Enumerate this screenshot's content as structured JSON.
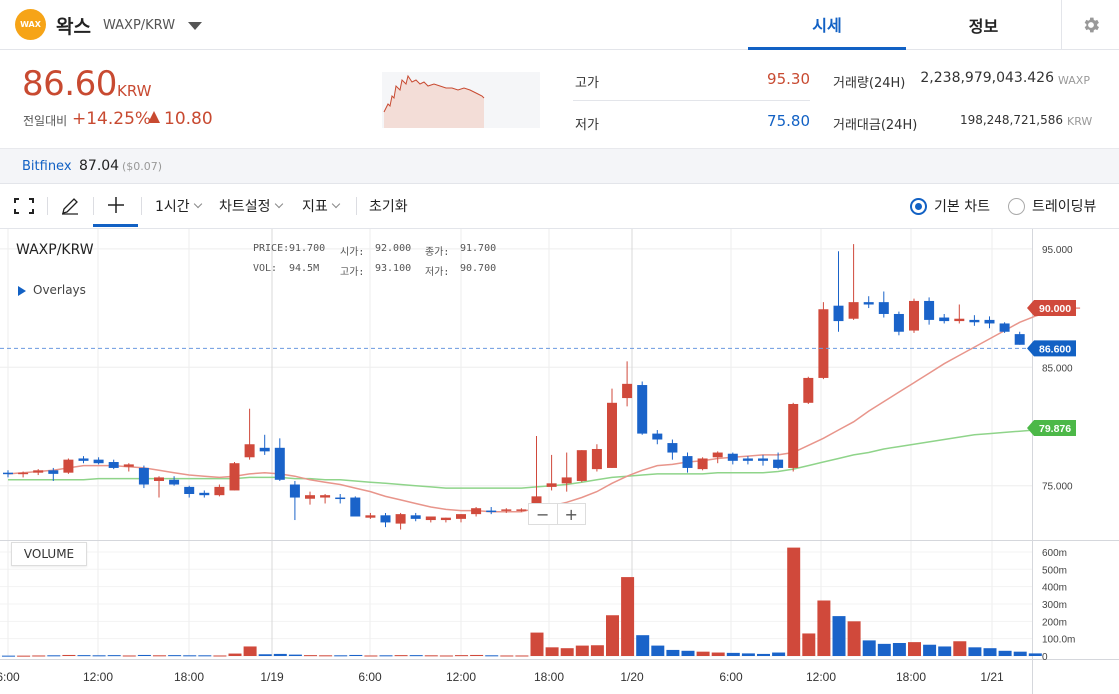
{
  "header": {
    "logo_text": "WAX",
    "coin_name": "왁스",
    "pair": "WAXP/KRW",
    "tabs": [
      "시세",
      "정보"
    ]
  },
  "summary": {
    "price": "86.60",
    "unit": "KRW",
    "change_label": "전일대비",
    "change_rate": "+14.25%",
    "change_amount": "10.80",
    "high_label": "고가",
    "high": "95.30",
    "low_label": "저가",
    "low": "75.80",
    "volume_label": "거래량(24H)",
    "volume": "2,238,979,043.426",
    "volume_unit": "WAXP",
    "value_label": "거래대금(24H)",
    "value": "198,248,721,586",
    "value_unit": "KRW"
  },
  "exchange": {
    "name": "Bitfinex",
    "price": "87.04",
    "diff": "($0.07)"
  },
  "toolbar": {
    "interval": "1시간",
    "chart_settings": "차트설정",
    "indicators": "지표",
    "reset": "초기화",
    "basic_chart": "기본 차트",
    "tradingview": "트레이딩뷰"
  },
  "chart": {
    "pair": "WAXP/KRW",
    "overlays_label": "Overlays",
    "ohlc": {
      "price_label": "PRICE:",
      "price": "91.700",
      "open_label": "시가:",
      "open": "92.000",
      "close_label": "종가:",
      "close": "91.700",
      "vol_label": "VOL:",
      "vol": "94.5M",
      "high_label": "고가:",
      "high": "93.100",
      "low_label": "저가:",
      "low": "90.700"
    },
    "volume_label": "VOLUME",
    "price_ticks": [
      "95.000",
      "85.000",
      "75.000"
    ],
    "volume_ticks": [
      "600m",
      "500m",
      "400m",
      "300m",
      "200m",
      "100.0m",
      "0"
    ],
    "time_ticks": [
      "6:00",
      "12:00",
      "18:00",
      "1/19",
      "6:00",
      "12:00",
      "18:00",
      "1/20",
      "6:00",
      "12:00",
      "18:00",
      "1/21"
    ],
    "markers": {
      "ma_short": "90.000",
      "last": "86.600",
      "ma_long": "79.876"
    },
    "colors": {
      "up": "#d0493b",
      "down": "#1a63c9",
      "ma_short": "#e8958b",
      "ma_long": "#8fd48a",
      "last_marker": "#1261c4",
      "ma_long_marker": "#4cb848"
    }
  },
  "chart_data": {
    "type": "candlestick",
    "y_range": [
      70.5,
      96
    ],
    "volume_range": [
      0,
      640
    ],
    "candles": [
      {
        "o": 76.1,
        "h": 76.3,
        "l": 75.7,
        "c": 76.0,
        "v": 2
      },
      {
        "o": 76.0,
        "h": 76.2,
        "l": 75.7,
        "c": 76.1,
        "v": 2
      },
      {
        "o": 76.1,
        "h": 76.4,
        "l": 75.9,
        "c": 76.3,
        "v": 3
      },
      {
        "o": 76.3,
        "h": 76.5,
        "l": 75.4,
        "c": 76.0,
        "v": 4
      },
      {
        "o": 76.1,
        "h": 77.3,
        "l": 76.0,
        "c": 77.2,
        "v": 6
      },
      {
        "o": 77.3,
        "h": 77.5,
        "l": 76.9,
        "c": 77.1,
        "v": 5
      },
      {
        "o": 77.2,
        "h": 77.4,
        "l": 76.8,
        "c": 76.9,
        "v": 4
      },
      {
        "o": 77.0,
        "h": 77.2,
        "l": 76.4,
        "c": 76.5,
        "v": 5
      },
      {
        "o": 76.6,
        "h": 76.9,
        "l": 76.2,
        "c": 76.8,
        "v": 3
      },
      {
        "o": 76.5,
        "h": 76.7,
        "l": 74.8,
        "c": 75.1,
        "v": 6
      },
      {
        "o": 75.4,
        "h": 75.8,
        "l": 74.0,
        "c": 75.7,
        "v": 4
      },
      {
        "o": 75.5,
        "h": 75.8,
        "l": 75.0,
        "c": 75.1,
        "v": 5
      },
      {
        "o": 74.9,
        "h": 75.0,
        "l": 74.0,
        "c": 74.3,
        "v": 4
      },
      {
        "o": 74.4,
        "h": 74.6,
        "l": 74.0,
        "c": 74.2,
        "v": 4
      },
      {
        "o": 74.2,
        "h": 75.1,
        "l": 74.1,
        "c": 74.9,
        "v": 3
      },
      {
        "o": 74.6,
        "h": 77.0,
        "l": 74.6,
        "c": 76.9,
        "v": 14
      },
      {
        "o": 77.4,
        "h": 81.5,
        "l": 77.2,
        "c": 78.5,
        "v": 55
      },
      {
        "o": 78.2,
        "h": 79.3,
        "l": 77.6,
        "c": 77.9,
        "v": 10
      },
      {
        "o": 78.2,
        "h": 79.0,
        "l": 75.4,
        "c": 75.5,
        "v": 12
      },
      {
        "o": 75.1,
        "h": 75.4,
        "l": 72.1,
        "c": 74.0,
        "v": 8
      },
      {
        "o": 73.9,
        "h": 74.5,
        "l": 73.4,
        "c": 74.2,
        "v": 5
      },
      {
        "o": 74.0,
        "h": 74.3,
        "l": 73.5,
        "c": 74.2,
        "v": 4
      },
      {
        "o": 74.0,
        "h": 74.3,
        "l": 73.5,
        "c": 73.9,
        "v": 4
      },
      {
        "o": 74.0,
        "h": 74.1,
        "l": 73.0,
        "c": 72.4,
        "v": 6
      },
      {
        "o": 72.3,
        "h": 72.7,
        "l": 72.2,
        "c": 72.5,
        "v": 3
      },
      {
        "o": 72.5,
        "h": 72.7,
        "l": 71.5,
        "c": 71.9,
        "v": 4
      },
      {
        "o": 71.8,
        "h": 72.7,
        "l": 71.3,
        "c": 72.6,
        "v": 5
      },
      {
        "o": 72.5,
        "h": 72.7,
        "l": 72.0,
        "c": 72.2,
        "v": 5
      },
      {
        "o": 72.1,
        "h": 72.4,
        "l": 71.9,
        "c": 72.4,
        "v": 4
      },
      {
        "o": 72.1,
        "h": 72.3,
        "l": 71.9,
        "c": 72.3,
        "v": 3
      },
      {
        "o": 72.2,
        "h": 72.6,
        "l": 71.9,
        "c": 72.6,
        "v": 5
      },
      {
        "o": 72.6,
        "h": 73.2,
        "l": 72.4,
        "c": 73.1,
        "v": 6
      },
      {
        "o": 72.9,
        "h": 73.2,
        "l": 72.6,
        "c": 72.8,
        "v": 4
      },
      {
        "o": 72.9,
        "h": 73.1,
        "l": 72.7,
        "c": 73.0,
        "v": 3
      },
      {
        "o": 72.9,
        "h": 73.1,
        "l": 72.8,
        "c": 73.0,
        "v": 3
      },
      {
        "o": 73.1,
        "h": 79.2,
        "l": 72.9,
        "c": 74.1,
        "v": 135
      },
      {
        "o": 74.9,
        "h": 77.6,
        "l": 74.6,
        "c": 75.2,
        "v": 50
      },
      {
        "o": 75.2,
        "h": 77.8,
        "l": 74.5,
        "c": 75.7,
        "v": 45
      },
      {
        "o": 75.4,
        "h": 78.0,
        "l": 75.3,
        "c": 78.0,
        "v": 60
      },
      {
        "o": 76.4,
        "h": 78.5,
        "l": 76.2,
        "c": 78.1,
        "v": 62
      },
      {
        "o": 76.5,
        "h": 83.2,
        "l": 76.5,
        "c": 82.0,
        "v": 235
      },
      {
        "o": 82.4,
        "h": 85.5,
        "l": 81.7,
        "c": 83.6,
        "v": 455
      },
      {
        "o": 83.5,
        "h": 83.8,
        "l": 79.3,
        "c": 79.4,
        "v": 120
      },
      {
        "o": 79.4,
        "h": 79.7,
        "l": 78.5,
        "c": 78.9,
        "v": 60
      },
      {
        "o": 78.6,
        "h": 78.9,
        "l": 77.2,
        "c": 77.8,
        "v": 35
      },
      {
        "o": 77.5,
        "h": 77.8,
        "l": 76.1,
        "c": 76.5,
        "v": 30
      },
      {
        "o": 76.4,
        "h": 77.4,
        "l": 76.3,
        "c": 77.3,
        "v": 25
      },
      {
        "o": 77.4,
        "h": 77.9,
        "l": 76.9,
        "c": 77.8,
        "v": 20
      },
      {
        "o": 77.7,
        "h": 77.8,
        "l": 76.8,
        "c": 77.1,
        "v": 18
      },
      {
        "o": 77.3,
        "h": 77.5,
        "l": 76.8,
        "c": 77.1,
        "v": 15
      },
      {
        "o": 77.3,
        "h": 77.6,
        "l": 76.7,
        "c": 77.1,
        "v": 12
      },
      {
        "o": 77.2,
        "h": 77.8,
        "l": 76.4,
        "c": 76.5,
        "v": 20
      },
      {
        "o": 76.5,
        "h": 82.0,
        "l": 76.2,
        "c": 81.9,
        "v": 625
      },
      {
        "o": 82.0,
        "h": 84.2,
        "l": 81.9,
        "c": 84.1,
        "v": 130
      },
      {
        "o": 84.1,
        "h": 90.5,
        "l": 84.0,
        "c": 89.9,
        "v": 320
      },
      {
        "o": 90.2,
        "h": 94.8,
        "l": 88.0,
        "c": 88.9,
        "v": 230
      },
      {
        "o": 89.1,
        "h": 95.4,
        "l": 89.0,
        "c": 90.5,
        "v": 200
      },
      {
        "o": 90.5,
        "h": 91.0,
        "l": 90.0,
        "c": 90.3,
        "v": 90
      },
      {
        "o": 90.5,
        "h": 91.4,
        "l": 89.2,
        "c": 89.5,
        "v": 70
      },
      {
        "o": 89.5,
        "h": 89.7,
        "l": 87.7,
        "c": 88.0,
        "v": 75
      },
      {
        "o": 88.1,
        "h": 90.8,
        "l": 87.9,
        "c": 90.6,
        "v": 80
      },
      {
        "o": 90.6,
        "h": 90.9,
        "l": 88.6,
        "c": 89.0,
        "v": 65
      },
      {
        "o": 89.2,
        "h": 89.5,
        "l": 88.7,
        "c": 88.9,
        "v": 55
      },
      {
        "o": 88.9,
        "h": 90.3,
        "l": 88.7,
        "c": 89.1,
        "v": 85
      },
      {
        "o": 89.0,
        "h": 89.4,
        "l": 88.5,
        "c": 88.8,
        "v": 50
      },
      {
        "o": 89.0,
        "h": 89.3,
        "l": 88.3,
        "c": 88.7,
        "v": 45
      },
      {
        "o": 88.7,
        "h": 88.8,
        "l": 87.9,
        "c": 88.0,
        "v": 30
      },
      {
        "o": 87.8,
        "h": 88.0,
        "l": 86.9,
        "c": 86.9,
        "v": 25
      },
      {
        "o": 86.8,
        "h": 86.9,
        "l": 86.3,
        "c": 86.4,
        "v": 15
      }
    ],
    "ma_short": [
      76.0,
      76.1,
      76.2,
      76.3,
      76.5,
      76.7,
      76.7,
      76.7,
      76.6,
      76.5,
      76.3,
      76.1,
      75.9,
      75.8,
      75.7,
      75.8,
      76.0,
      76.1,
      76.0,
      75.8,
      75.5,
      75.3,
      75.1,
      74.8,
      74.5,
      74.1,
      73.8,
      73.5,
      73.2,
      73.0,
      72.9,
      72.9,
      72.8,
      72.8,
      72.8,
      73.1,
      73.3,
      73.6,
      74.0,
      74.5,
      75.2,
      75.8,
      76.3,
      76.7,
      76.8,
      77.0,
      77.1,
      77.3,
      77.4,
      77.5,
      77.6,
      77.6,
      77.8,
      78.4,
      79.0,
      79.7,
      80.4,
      81.3,
      82.1,
      82.9,
      83.7,
      84.5,
      85.3,
      86.0,
      86.7,
      87.4,
      88.1,
      88.8,
      89.3,
      89.7,
      90.0,
      90.0
    ],
    "ma_long": [
      75.5,
      75.5,
      75.5,
      75.5,
      75.5,
      75.5,
      75.6,
      75.6,
      75.6,
      75.6,
      75.6,
      75.6,
      75.6,
      75.6,
      75.6,
      75.6,
      75.7,
      75.7,
      75.7,
      75.6,
      75.6,
      75.5,
      75.5,
      75.4,
      75.3,
      75.2,
      75.1,
      75.0,
      74.9,
      74.8,
      74.8,
      74.8,
      74.8,
      74.8,
      74.8,
      74.9,
      75.0,
      75.1,
      75.3,
      75.5,
      75.7,
      75.8,
      75.9,
      76.0,
      76.0,
      76.0,
      76.0,
      76.1,
      76.1,
      76.1,
      76.1,
      76.2,
      76.4,
      76.7,
      77.0,
      77.3,
      77.6,
      77.8,
      78.1,
      78.3,
      78.5,
      78.7,
      78.9,
      79.1,
      79.3,
      79.4,
      79.5,
      79.6,
      79.7,
      79.8,
      79.9
    ]
  }
}
